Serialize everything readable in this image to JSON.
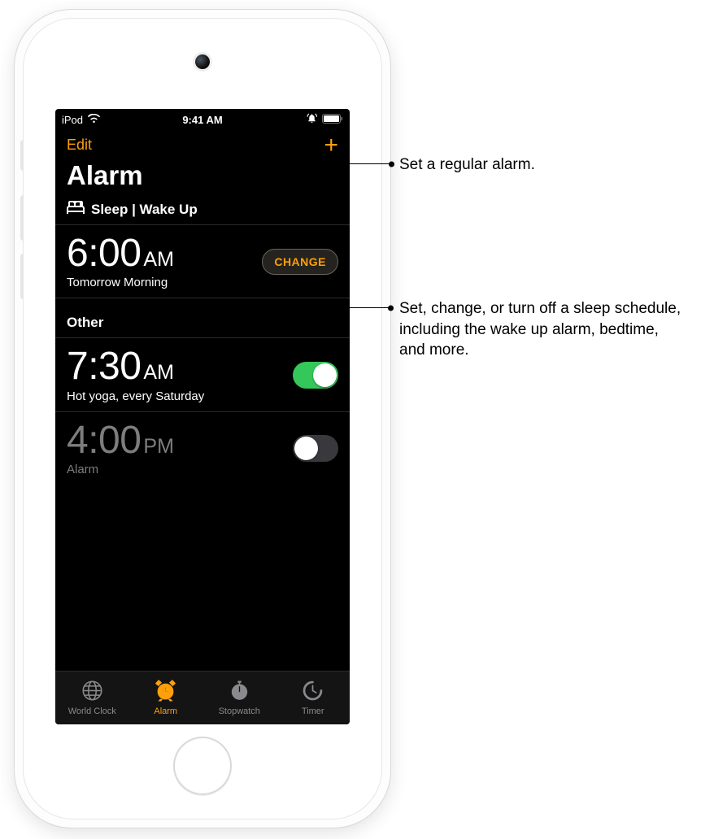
{
  "statusbar": {
    "device": "iPod",
    "time": "9:41 AM"
  },
  "navbar": {
    "edit": "Edit"
  },
  "title": "Alarm",
  "sleep": {
    "header": "Sleep | Wake Up",
    "time": "6:00",
    "ampm": "AM",
    "sub": "Tomorrow Morning",
    "change": "CHANGE"
  },
  "other": {
    "header": "Other",
    "alarms": [
      {
        "time": "7:30",
        "ampm": "AM",
        "sub": "Hot yoga, every Saturday",
        "on": true
      },
      {
        "time": "4:00",
        "ampm": "PM",
        "sub": "Alarm",
        "on": false
      }
    ]
  },
  "tabs": [
    {
      "label": "World Clock"
    },
    {
      "label": "Alarm"
    },
    {
      "label": "Stopwatch"
    },
    {
      "label": "Timer"
    }
  ],
  "callouts": {
    "add": "Set a regular alarm.",
    "change": "Set, change, or turn off a sleep schedule, including the wake up alarm, bedtime, and more."
  }
}
